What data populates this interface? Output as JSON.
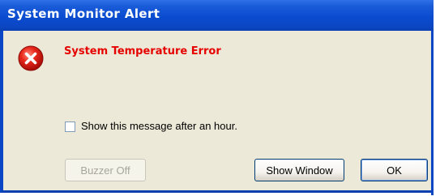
{
  "window": {
    "title": "System Monitor Alert"
  },
  "alert": {
    "icon": "error-icon",
    "message": "System Temperature Error",
    "message_color": "#e60000"
  },
  "checkbox": {
    "label": "Show this message after an hour.",
    "checked": false
  },
  "buttons": {
    "buzzer_off": "Buzzer Off",
    "show_window": "Show Window",
    "ok": "OK"
  },
  "colors": {
    "titlebar": "#0a4cd0",
    "dialog_bg": "#ece9d8",
    "error_red": "#e60000"
  }
}
